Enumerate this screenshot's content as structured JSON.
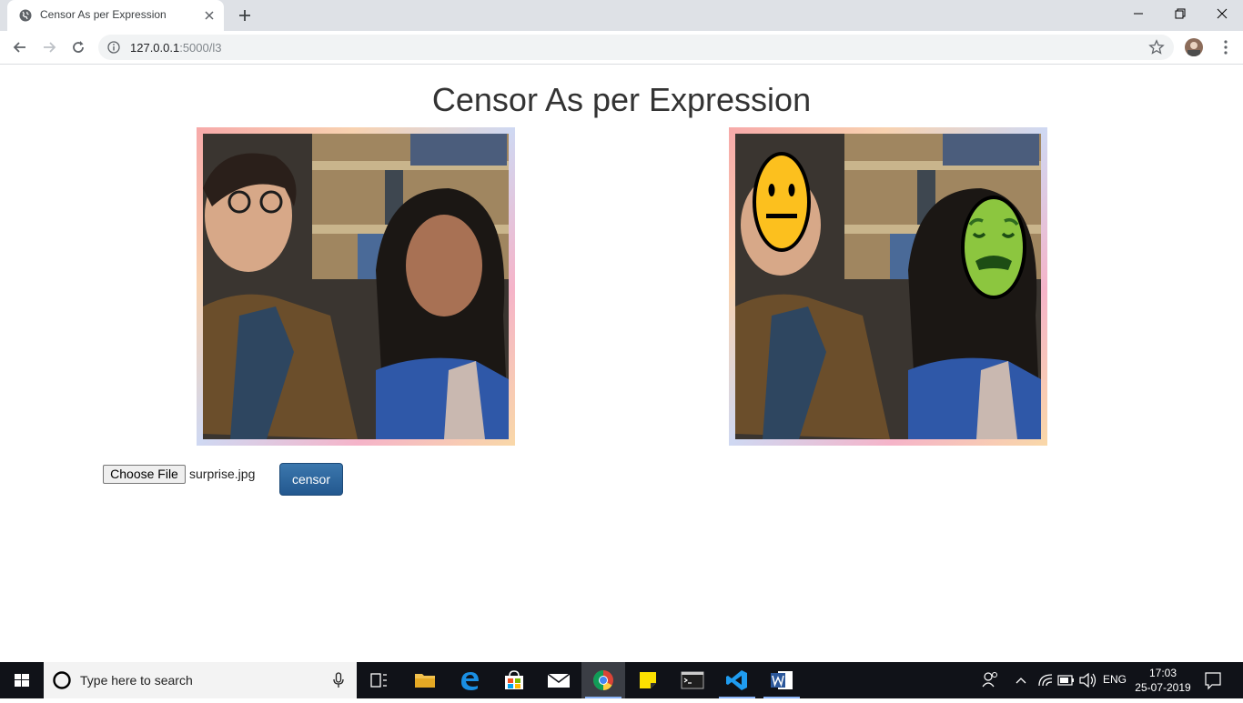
{
  "browser": {
    "tab_title": "Censor As per Expression",
    "url_host": "127.0.0.1",
    "url_path": ":5000/l3"
  },
  "page": {
    "heading": "Censor As per Expression",
    "file_button_label": "Choose File",
    "file_name": "surprise.jpg",
    "censor_button_label": "censor"
  },
  "taskbar": {
    "search_placeholder": "Type here to search",
    "language": "ENG",
    "time": "17:03",
    "date": "25-07-2019"
  }
}
